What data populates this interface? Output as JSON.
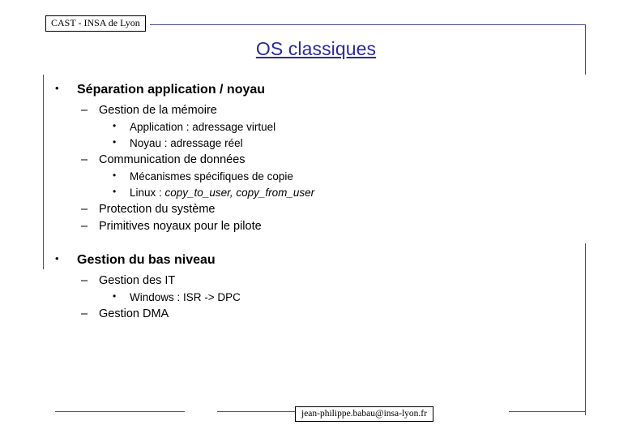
{
  "header": {
    "institution": "CAST - INSA de Lyon"
  },
  "title": "OS classiques",
  "bullets": {
    "b1": {
      "marker": "•",
      "text": "Séparation application / noyau"
    },
    "b1_sub1": {
      "marker": "–",
      "text": "Gestion de la mémoire"
    },
    "b1_sub1_a": {
      "marker": "•",
      "text": "Application : adressage virtuel"
    },
    "b1_sub1_b": {
      "marker": "•",
      "text": "Noyau : adressage réel"
    },
    "b1_sub2": {
      "marker": "–",
      "text": "Communication de données"
    },
    "b1_sub2_a": {
      "marker": "•",
      "text": "Mécanismes spécifiques de copie"
    },
    "b1_sub2_b": {
      "marker": "•",
      "prefix": "Linux : ",
      "code": "copy_to_user, copy_from_user"
    },
    "b1_sub3": {
      "marker": "–",
      "text": "Protection du système"
    },
    "b1_sub4": {
      "marker": "–",
      "text": "Primitives noyaux pour le pilote"
    },
    "b2": {
      "marker": "•",
      "text": "Gestion du bas niveau"
    },
    "b2_sub1": {
      "marker": "–",
      "text": "Gestion des IT"
    },
    "b2_sub1_a": {
      "marker": "•",
      "text": "Windows : ISR -> DPC"
    },
    "b2_sub2": {
      "marker": "–",
      "text": "Gestion DMA"
    }
  },
  "footer": {
    "email": "jean-philippe.babau@insa-lyon.fr"
  },
  "colors": {
    "title": "#2a2a9a",
    "frame": "#4a4a8a",
    "text": "#000000",
    "background": "#ffffff"
  }
}
